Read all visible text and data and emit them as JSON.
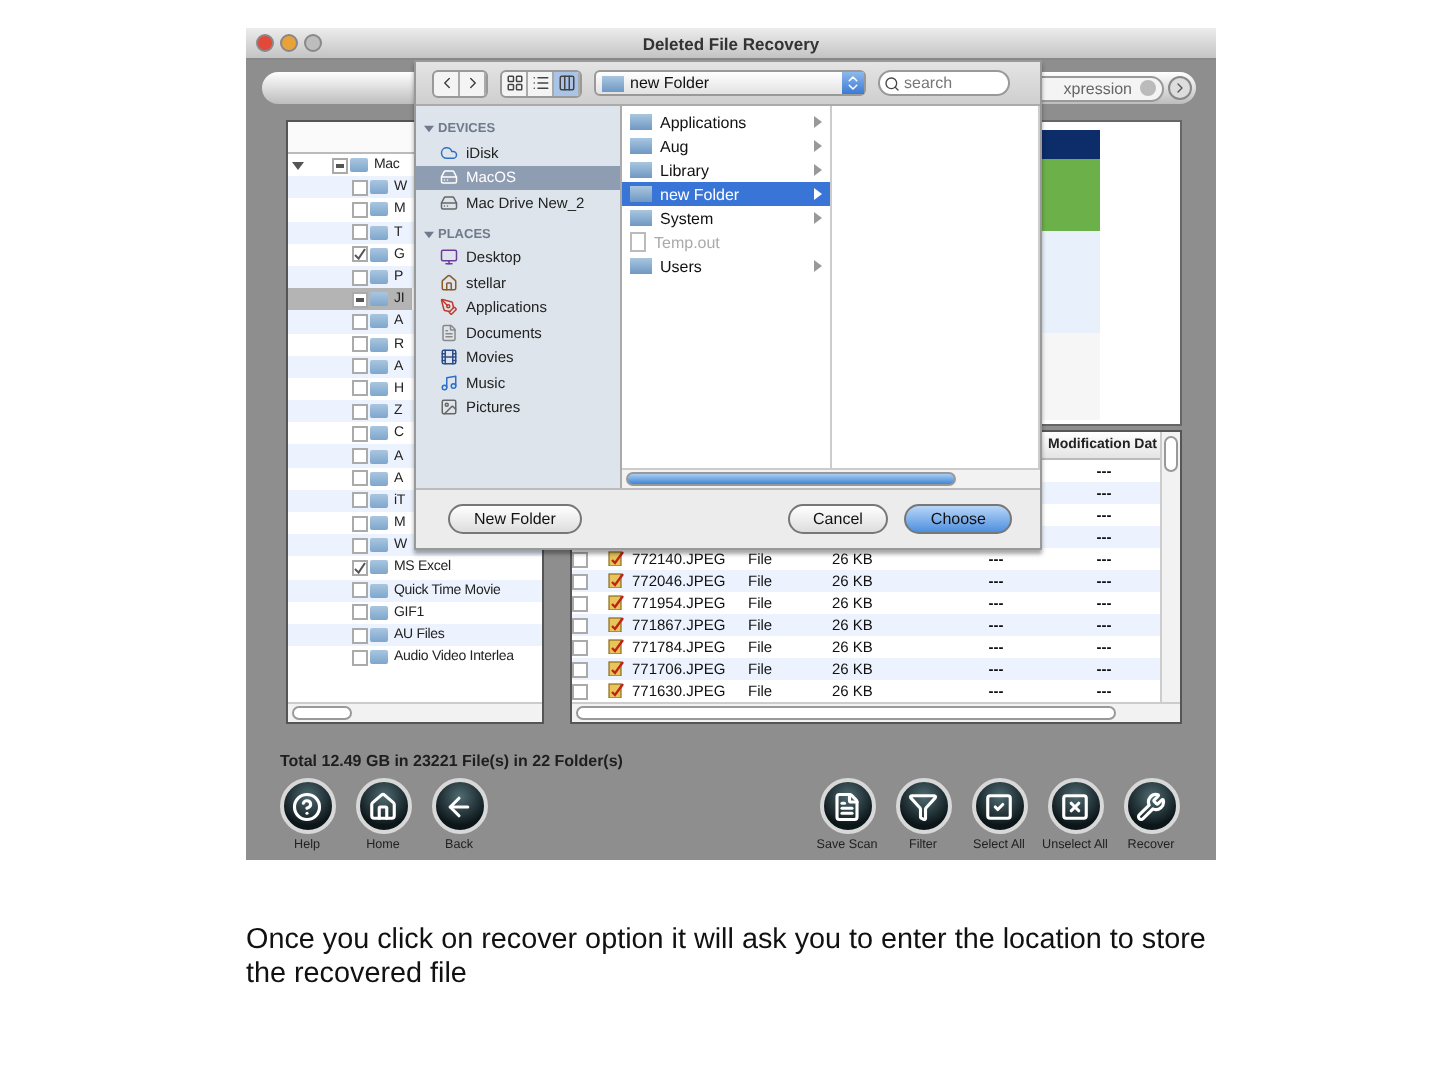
{
  "window": {
    "title": "Deleted File Recovery"
  },
  "toolbar": {
    "search": {
      "value": "xpression"
    }
  },
  "tree": {
    "label": "Mac",
    "expanded": true,
    "checked": false,
    "mixed": true,
    "selected": false,
    "children": [
      {
        "label": "W",
        "checked": false,
        "mixed": false,
        "selected": false
      },
      {
        "label": "M",
        "checked": false,
        "mixed": false,
        "selected": false
      },
      {
        "label": "T",
        "checked": false,
        "mixed": false,
        "selected": false
      },
      {
        "label": "G",
        "checked": true,
        "mixed": false,
        "selected": false
      },
      {
        "label": "P",
        "checked": false,
        "mixed": false,
        "selected": false
      },
      {
        "label": "JI",
        "checked": false,
        "mixed": true,
        "selected": true
      },
      {
        "label": "A",
        "checked": false,
        "mixed": false,
        "selected": false
      },
      {
        "label": "R",
        "checked": false,
        "mixed": false,
        "selected": false
      },
      {
        "label": "A",
        "checked": false,
        "mixed": false,
        "selected": false
      },
      {
        "label": "H",
        "checked": false,
        "mixed": false,
        "selected": false
      },
      {
        "label": "Z",
        "checked": false,
        "mixed": false,
        "selected": false
      },
      {
        "label": "C",
        "checked": false,
        "mixed": false,
        "selected": false
      },
      {
        "label": "A",
        "checked": false,
        "mixed": false,
        "selected": false
      },
      {
        "label": "A",
        "checked": false,
        "mixed": false,
        "selected": false
      },
      {
        "label": "iT",
        "checked": false,
        "mixed": false,
        "selected": false
      },
      {
        "label": "M",
        "checked": false,
        "mixed": false,
        "selected": false
      },
      {
        "label": "W",
        "checked": false,
        "mixed": false,
        "selected": false
      },
      {
        "label": "MS Excel",
        "checked": true,
        "mixed": false,
        "selected": false
      },
      {
        "label": "Quick Time Movie",
        "checked": false,
        "mixed": false,
        "selected": false
      },
      {
        "label": "GIF1",
        "checked": false,
        "mixed": false,
        "selected": false
      },
      {
        "label": "AU Files",
        "checked": false,
        "mixed": false,
        "selected": false
      },
      {
        "label": "Audio Video Interlea",
        "checked": false,
        "mixed": false,
        "selected": false
      }
    ]
  },
  "file_table": {
    "columns": [
      "Modification Dat"
    ],
    "rows": [
      {
        "modified": "---"
      },
      {
        "modified": "---"
      },
      {
        "modified": "---"
      },
      {
        "modified": "---"
      },
      {
        "checked": false,
        "name": "772140.JPEG",
        "type": "File",
        "size": "26 KB",
        "created": "---",
        "modified": "---"
      },
      {
        "checked": false,
        "name": "772046.JPEG",
        "type": "File",
        "size": "26 KB",
        "created": "---",
        "modified": "---"
      },
      {
        "checked": false,
        "name": "771954.JPEG",
        "type": "File",
        "size": "26 KB",
        "created": "---",
        "modified": "---"
      },
      {
        "checked": false,
        "name": "771867.JPEG",
        "type": "File",
        "size": "26 KB",
        "created": "---",
        "modified": "---"
      },
      {
        "checked": false,
        "name": "771784.JPEG",
        "type": "File",
        "size": "26 KB",
        "created": "---",
        "modified": "---"
      },
      {
        "checked": false,
        "name": "771706.JPEG",
        "type": "File",
        "size": "26 KB",
        "created": "---",
        "modified": "---"
      },
      {
        "checked": false,
        "name": "771630.JPEG",
        "type": "File",
        "size": "26 KB",
        "created": "---",
        "modified": "---"
      }
    ]
  },
  "status": "Total 12.49 GB in 23221 File(s) in 22 Folder(s)",
  "actions_left": [
    {
      "kind": "help",
      "label": "Help"
    },
    {
      "kind": "home",
      "label": "Home"
    },
    {
      "kind": "back",
      "label": "Back"
    }
  ],
  "actions_right": [
    {
      "kind": "save",
      "label": "Save Scan"
    },
    {
      "kind": "filter",
      "label": "Filter"
    },
    {
      "kind": "select",
      "label": "Select All"
    },
    {
      "kind": "unselect",
      "label": "Unselect All"
    },
    {
      "kind": "recover",
      "label": "Recover"
    }
  ],
  "dialog": {
    "view_modes": [
      {
        "kind": "icons",
        "selected": false
      },
      {
        "kind": "list",
        "selected": false
      },
      {
        "kind": "columns",
        "selected": true
      }
    ],
    "path": "new Folder",
    "search": {
      "placeholder": "search"
    },
    "sidebar": [
      {
        "heading": "DEVICES",
        "expanded": true,
        "items": [
          {
            "kind": "idisk",
            "label": "iDisk",
            "selected": false
          },
          {
            "kind": "drive",
            "label": "MacOS",
            "selected": true
          },
          {
            "kind": "drive",
            "label": "Mac Drive New_2",
            "selected": false
          }
        ]
      },
      {
        "heading": "PLACES",
        "expanded": true,
        "items": [
          {
            "kind": "desktop",
            "label": "Desktop",
            "selected": false
          },
          {
            "kind": "home",
            "label": "stellar",
            "selected": false
          },
          {
            "kind": "applications",
            "label": "Applications",
            "selected": false
          },
          {
            "kind": "documents",
            "label": "Documents",
            "selected": false
          },
          {
            "kind": "movies",
            "label": "Movies",
            "selected": false
          },
          {
            "kind": "music",
            "label": "Music",
            "selected": false
          },
          {
            "kind": "pictures",
            "label": "Pictures",
            "selected": false
          }
        ]
      }
    ],
    "column": [
      {
        "kind": "folder",
        "label": "Applications",
        "selected": false,
        "disabled": false
      },
      {
        "kind": "folder",
        "label": "Aug",
        "selected": false,
        "disabled": false
      },
      {
        "kind": "folder",
        "label": "Library",
        "selected": false,
        "disabled": false
      },
      {
        "kind": "folder",
        "label": "new Folder",
        "selected": true,
        "disabled": false
      },
      {
        "kind": "folder",
        "label": "System",
        "selected": false,
        "disabled": false
      },
      {
        "kind": "file",
        "label": "Temp.out",
        "selected": false,
        "disabled": true
      },
      {
        "kind": "folder",
        "label": "Users",
        "selected": false,
        "disabled": false
      }
    ],
    "new_folder": {
      "label": "New Folder"
    },
    "buttons": [
      {
        "label": "Cancel",
        "default": false
      },
      {
        "label": "Choose",
        "default": true
      }
    ]
  },
  "caption": "Once you click on recover option it will ask you to enter the location to store the recovered file"
}
